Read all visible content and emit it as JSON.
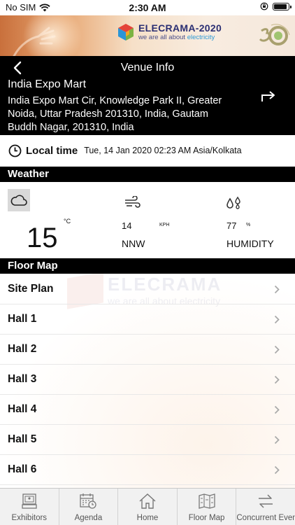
{
  "status": {
    "carrier": "No SIM",
    "time": "2:30 AM"
  },
  "brand": {
    "name": "ELECRAMA-2020",
    "tagline_prefix": "we are all about ",
    "tagline_highlight": "electricity"
  },
  "header": {
    "title": "Venue Info",
    "venue_name": "India Expo Mart",
    "address": "India Expo Mart Cir, Knowledge Park II, Greater Noida, Uttar Pradesh 201310, India, Gautam Buddh Nagar, 201310, India"
  },
  "local_time": {
    "label": "Local time",
    "value": "Tue, 14 Jan 2020 02:23 AM Asia/Kolkata"
  },
  "weather": {
    "section_title": "Weather",
    "temperature": "15",
    "temp_unit": "°C",
    "wind_speed": "14",
    "wind_unit": "KPH",
    "wind_direction": "NNW",
    "humidity": "77",
    "humidity_unit": "%",
    "humidity_label": "HUMIDITY"
  },
  "floor_map": {
    "section_title": "Floor Map",
    "items": [
      {
        "label": "Site Plan"
      },
      {
        "label": "Hall 1"
      },
      {
        "label": "Hall 2"
      },
      {
        "label": "Hall 3"
      },
      {
        "label": "Hall 4"
      },
      {
        "label": "Hall 5"
      },
      {
        "label": "Hall 6"
      }
    ]
  },
  "tabs": [
    {
      "label": "Exhibitors"
    },
    {
      "label": "Agenda"
    },
    {
      "label": "Home"
    },
    {
      "label": "Floor Map"
    },
    {
      "label": "Concurrent Events"
    }
  ]
}
